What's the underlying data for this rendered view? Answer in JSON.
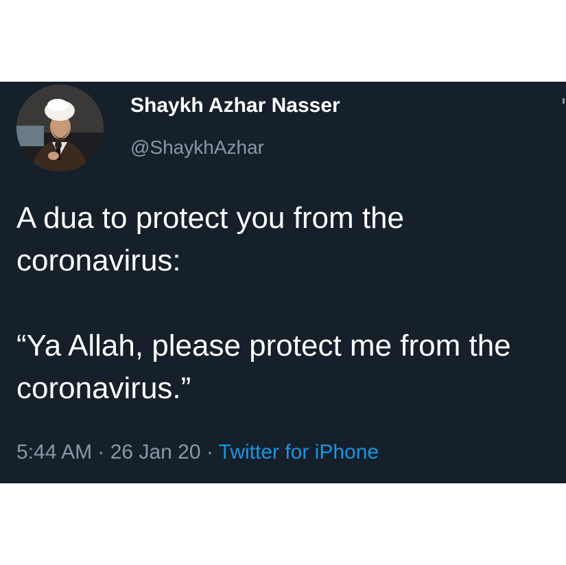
{
  "tweet": {
    "display_name": "Shaykh Azhar Nasser",
    "handle": "@ShaykhAzhar",
    "text_line1": "A dua to protect you from the coronavirus:",
    "text_quote": "“Ya Allah, please protect me from the coronavirus.”",
    "time": "5:44 AM",
    "separator": " · ",
    "date": "26 Jan 20",
    "source": "Twitter for iPhone",
    "colors": {
      "background": "#15202b",
      "text": "#ffffff",
      "muted": "#8899a6",
      "link": "#1b95e0"
    },
    "avatar_icon": "profile-photo"
  }
}
